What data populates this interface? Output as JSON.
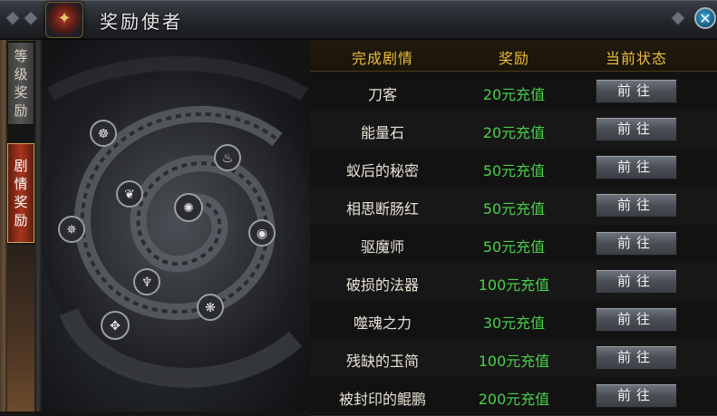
{
  "window": {
    "title": "奖励使者",
    "close_glyph": "✕",
    "emblem_icon": "guild-crest-icon"
  },
  "side_tabs": [
    {
      "label": [
        "等",
        "级",
        "奖",
        "励"
      ],
      "active": false
    },
    {
      "label": [
        "剧",
        "情",
        "奖",
        "励"
      ],
      "active": true
    }
  ],
  "table": {
    "headers": {
      "story": "完成剧情",
      "reward": "奖励",
      "status": "当前状态"
    },
    "rows": [
      {
        "story": "刀客",
        "reward": "20元充值",
        "action": "前往"
      },
      {
        "story": "能量石",
        "reward": "20元充值",
        "action": "前往"
      },
      {
        "story": "蚁后的秘密",
        "reward": "50元充值",
        "action": "前往"
      },
      {
        "story": "相思断肠红",
        "reward": "50元充值",
        "action": "前往"
      },
      {
        "story": "驱魔师",
        "reward": "50元充值",
        "action": "前往"
      },
      {
        "story": "破损的法器",
        "reward": "100元充值",
        "action": "前往"
      },
      {
        "story": "噬魂之力",
        "reward": "30元充值",
        "action": "前往"
      },
      {
        "story": "残缺的玉简",
        "reward": "100元充值",
        "action": "前往"
      },
      {
        "story": "被封印的鲲鹏",
        "reward": "200元充值",
        "action": "前往"
      }
    ]
  },
  "colors": {
    "header_gold": "#ebbf3a",
    "reward_green": "#4ad04a",
    "active_tab_red": "#a8361d"
  },
  "art": {
    "rune_icons": [
      "spiral-rune-icon",
      "flame-rune-icon",
      "wing-rune-icon",
      "claw-rune-icon",
      "eye-rune-icon",
      "star-rune-icon",
      "trident-rune-icon",
      "vortex-rune-icon",
      "shield-rune-icon"
    ]
  }
}
